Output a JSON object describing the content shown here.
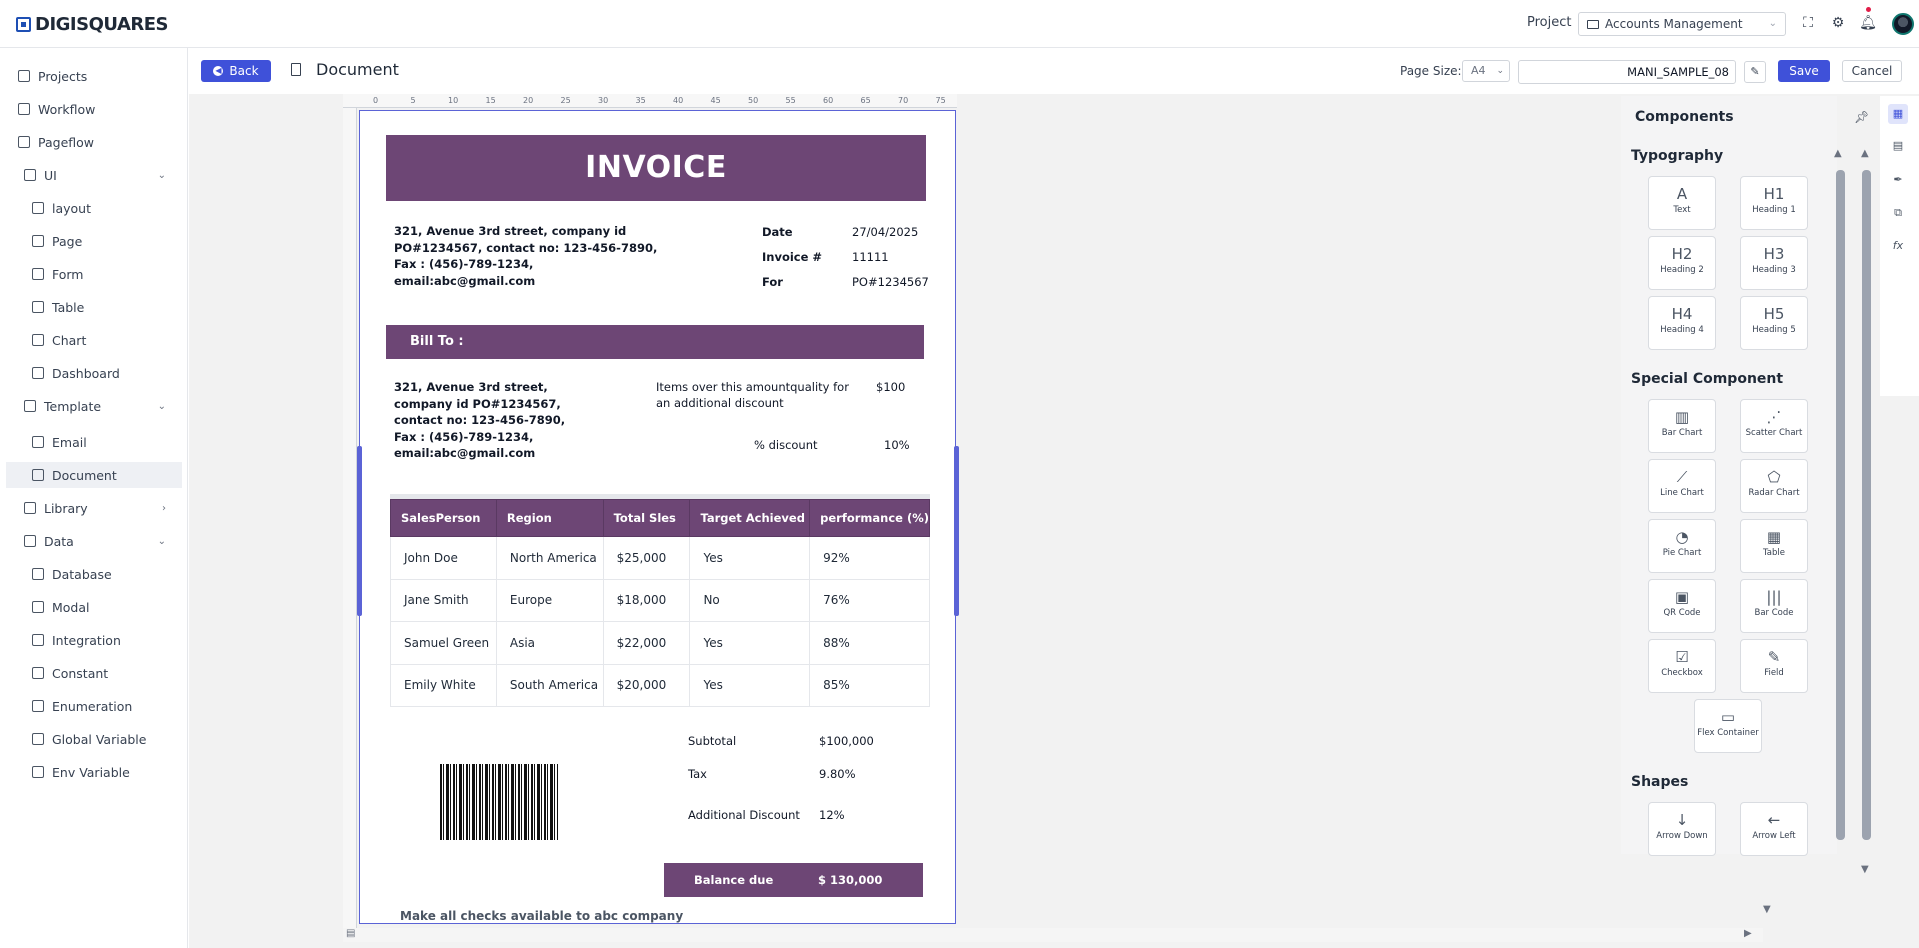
{
  "brand": {
    "name": "DIGISQUARES"
  },
  "header": {
    "project_label": "Project",
    "project_value": "Accounts Management"
  },
  "sidebar": {
    "items": [
      {
        "label": "Projects"
      },
      {
        "label": "Workflow"
      },
      {
        "label": "Pageflow"
      },
      {
        "label": "UI"
      },
      {
        "label": "layout"
      },
      {
        "label": "Page"
      },
      {
        "label": "Form"
      },
      {
        "label": "Table"
      },
      {
        "label": "Chart"
      },
      {
        "label": "Dashboard"
      },
      {
        "label": "Template"
      },
      {
        "label": "Email"
      },
      {
        "label": "Document"
      },
      {
        "label": "Library"
      },
      {
        "label": "Data"
      },
      {
        "label": "Database"
      },
      {
        "label": "Modal"
      },
      {
        "label": "Integration"
      },
      {
        "label": "Constant"
      },
      {
        "label": "Enumeration"
      },
      {
        "label": "Global Variable"
      },
      {
        "label": "Env Variable"
      }
    ]
  },
  "toolbar": {
    "back_label": "Back",
    "title": "Document",
    "page_size_label": "Page Size:",
    "page_size_value": "A4",
    "doc_name": "MANI_SAMPLE_08",
    "save_label": "Save",
    "cancel_label": "Cancel"
  },
  "ruler": {
    "marks": [
      "0",
      "5",
      "10",
      "15",
      "20",
      "25",
      "30",
      "35",
      "40",
      "45",
      "50",
      "55",
      "60",
      "65",
      "70",
      "75"
    ]
  },
  "invoice": {
    "title": "INVOICE",
    "from_address": [
      "321, Avenue 3rd street, company id",
      "PO#1234567, contact no: 123-456-7890,",
      "Fax : (456)-789-1234,",
      "email:abc@gmail.com"
    ],
    "date_label": "Date",
    "date_value": "27/04/2025",
    "invoice_label": "Invoice #",
    "invoice_value": "11111",
    "for_label": "For",
    "for_value": "PO#1234567",
    "bill_to_label": "Bill To :",
    "bill_address": [
      "321, Avenue 3rd street,",
      "company id PO#1234567,",
      "contact no: 123-456-7890,",
      "Fax : (456)-789-1234,",
      "email:abc@gmail.com"
    ],
    "discount_note": [
      "Items over this amountquality for",
      "an additional discount"
    ],
    "discount_threshold": "$100",
    "discount_label": "% discount",
    "discount_value": "10%",
    "table": {
      "headers": [
        "SalesPerson",
        "Region",
        "Total Sles",
        "Target Achieved",
        "performance (%)"
      ],
      "rows": [
        [
          "John Doe",
          "North America",
          "$25,000",
          "Yes",
          "92%"
        ],
        [
          "Jane Smith",
          "Europe",
          "$18,000",
          "No",
          "76%"
        ],
        [
          "Samuel Green",
          "Asia",
          "$22,000",
          "Yes",
          "88%"
        ],
        [
          "Emily White",
          "South America",
          "$20,000",
          "Yes",
          "85%"
        ]
      ]
    },
    "subtotal_label": "Subtotal",
    "subtotal_value": "$100,000",
    "tax_label": "Tax",
    "tax_value": "9.80%",
    "add_discount_label": "Additional Discount",
    "add_discount_value": "12%",
    "balance_label": "Balance due",
    "balance_value": "$ 130,000",
    "footer_note": "Make all checks available to abc company"
  },
  "components_panel": {
    "title": "Components",
    "sections": {
      "typography": "Typography",
      "special": "Special Component",
      "shapes": "Shapes"
    },
    "typography_items": [
      {
        "glyph": "A",
        "label": "Text"
      },
      {
        "glyph": "H1",
        "label": "Heading 1"
      },
      {
        "glyph": "H2",
        "label": "Heading 2"
      },
      {
        "glyph": "H3",
        "label": "Heading 3"
      },
      {
        "glyph": "H4",
        "label": "Heading 4"
      },
      {
        "glyph": "H5",
        "label": "Heading 5"
      }
    ],
    "special_items": [
      {
        "glyph": "▥",
        "label": "Bar Chart"
      },
      {
        "glyph": "⋰",
        "label": "Scatter Chart"
      },
      {
        "glyph": "⟋",
        "label": "Line Chart"
      },
      {
        "glyph": "⬠",
        "label": "Radar Chart"
      },
      {
        "glyph": "◔",
        "label": "Pie Chart"
      },
      {
        "glyph": "▦",
        "label": "Table"
      },
      {
        "glyph": "▣",
        "label": "QR Code"
      },
      {
        "glyph": "|||",
        "label": "Bar Code"
      },
      {
        "glyph": "☑",
        "label": "Checkbox"
      },
      {
        "glyph": "✎",
        "label": "Field"
      },
      {
        "glyph": "▭",
        "label": "Flex Container"
      }
    ],
    "shape_items": [
      {
        "glyph": "↓",
        "label": "Arrow Down"
      },
      {
        "glyph": "←",
        "label": "Arrow Left"
      },
      {
        "glyph": "→",
        "label": ""
      },
      {
        "glyph": "↑",
        "label": ""
      }
    ]
  },
  "colors": {
    "accent": "#3f51d9",
    "invoice_purple": "#6d4675"
  }
}
